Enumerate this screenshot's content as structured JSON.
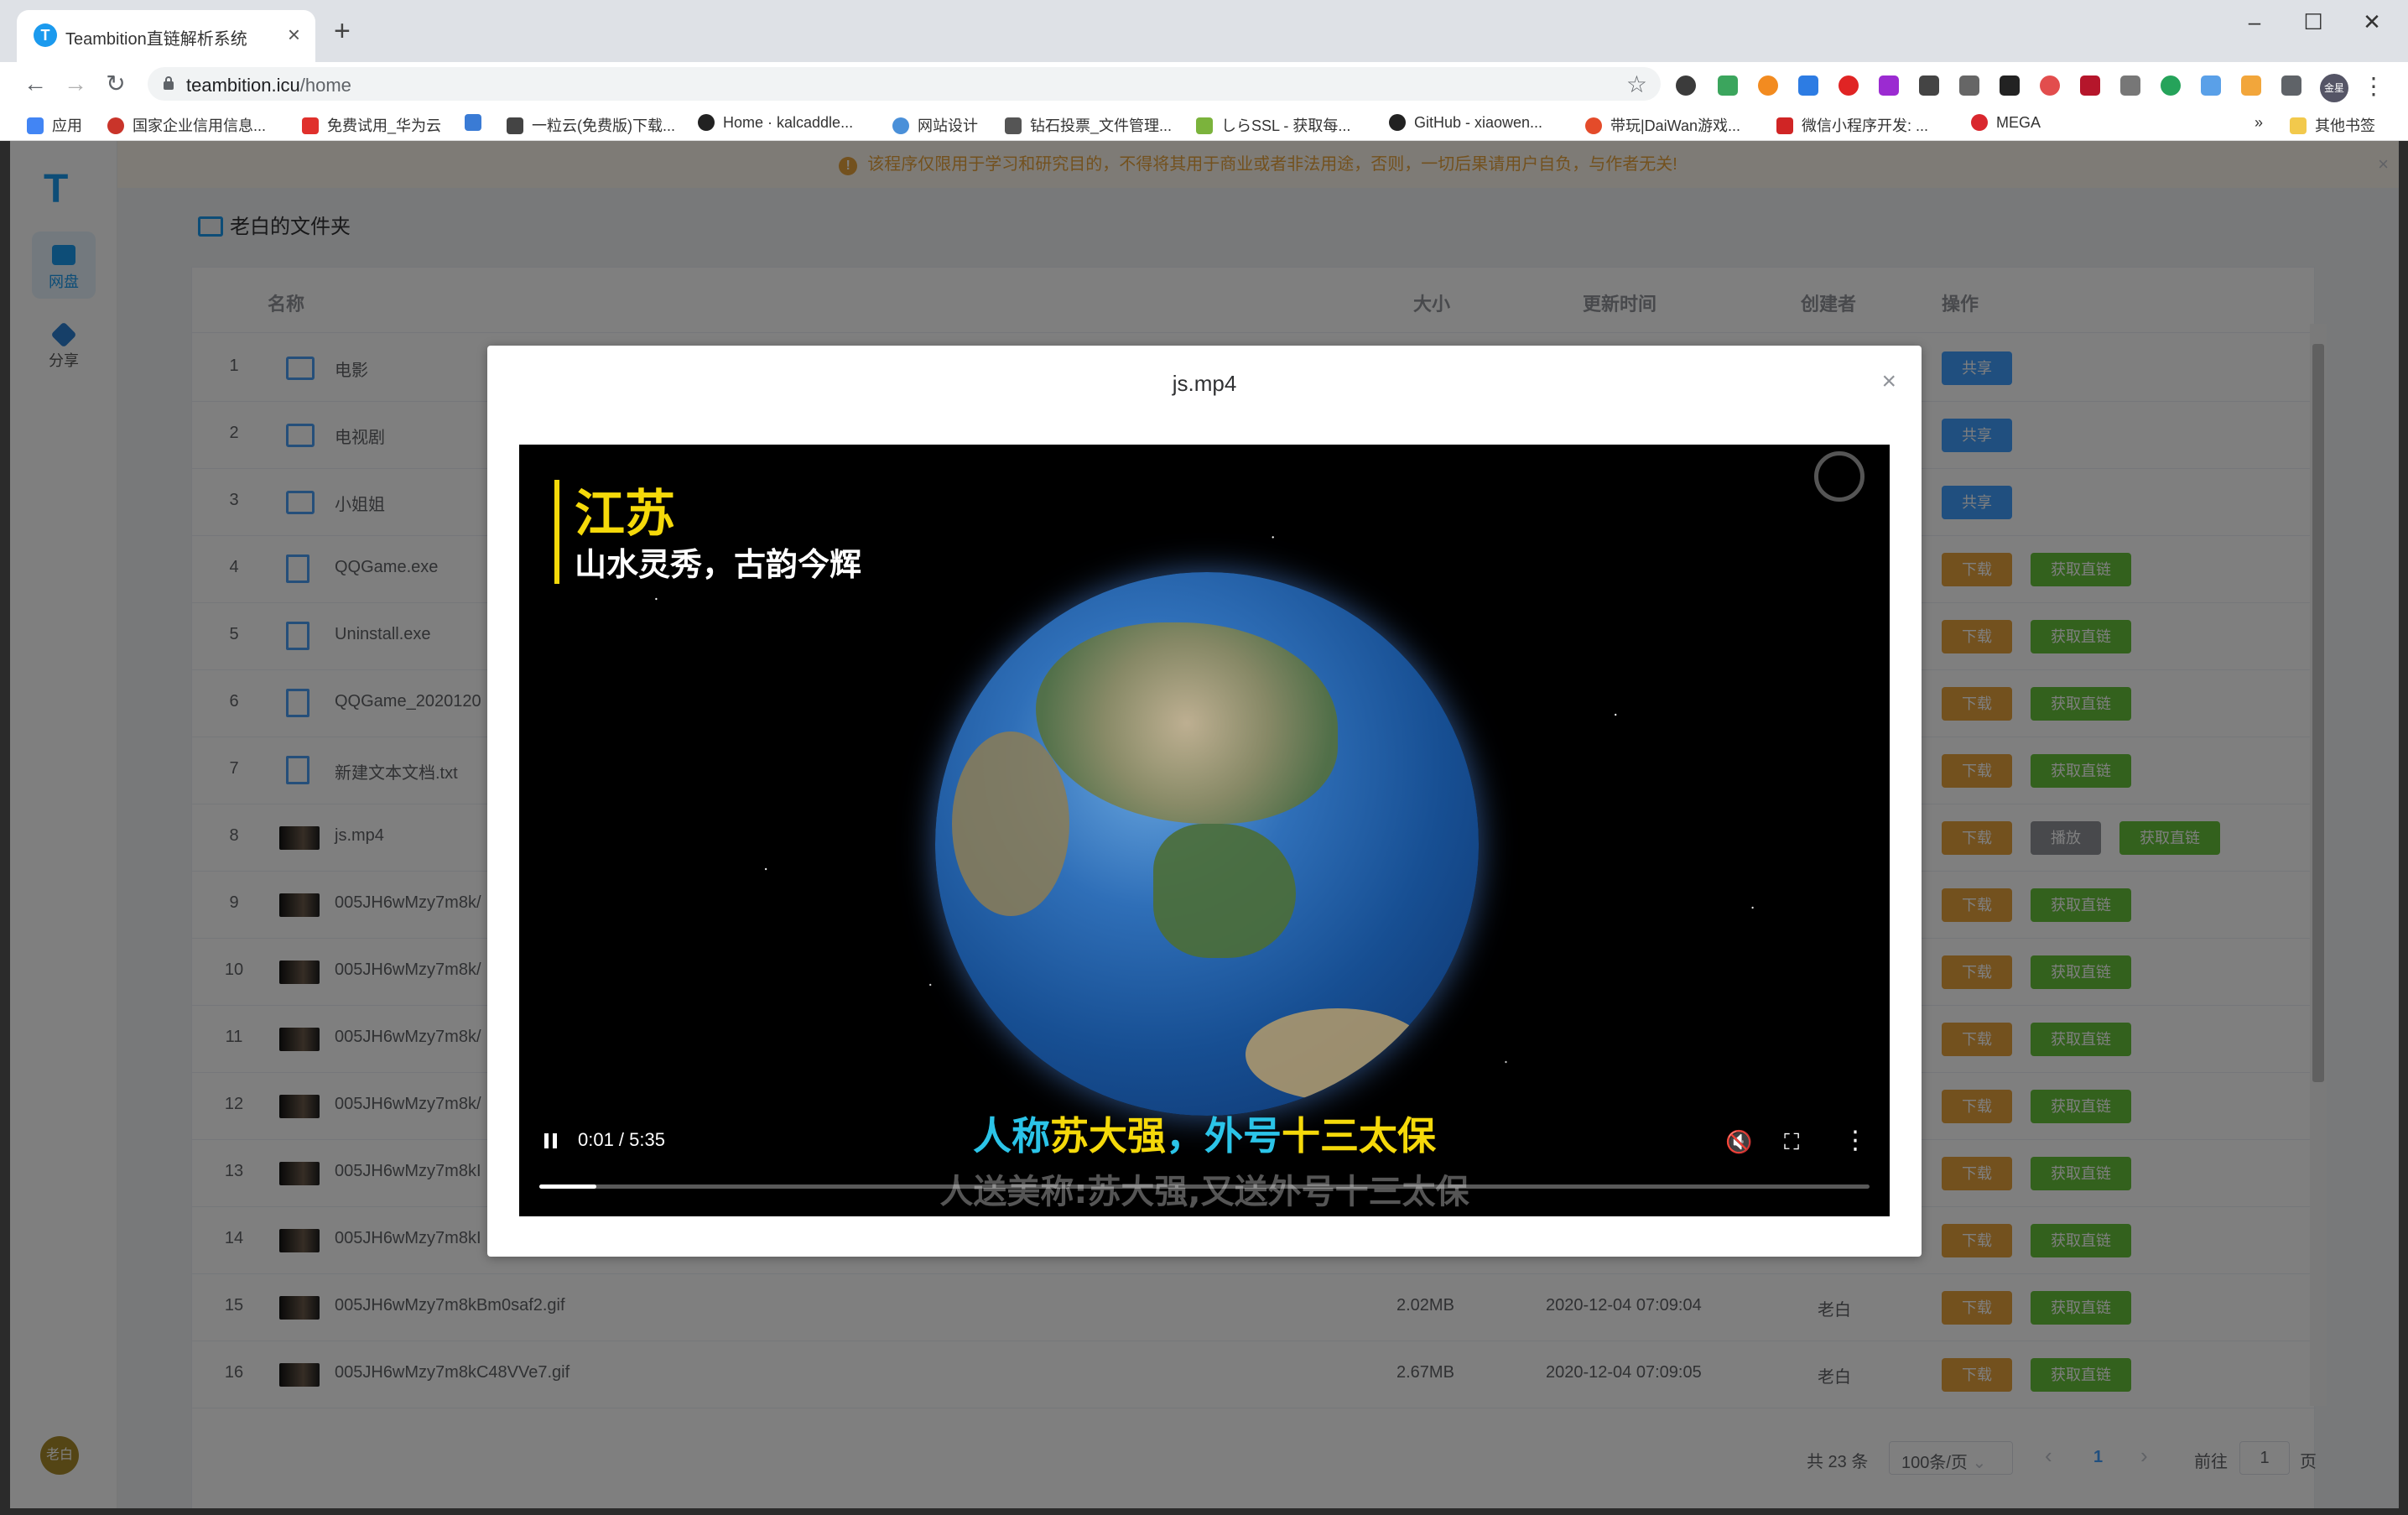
{
  "browser": {
    "tab_title": "Teambition直链解析系统",
    "tab_favicon": "T",
    "new_tab": "+",
    "url_host": "teambition.icu",
    "url_path": "/home",
    "window_controls": [
      "–",
      "☐",
      "✕"
    ]
  },
  "bookmarks": [
    {
      "label": "应用",
      "icon": "apps-grid-icon",
      "color": "#4285f4"
    },
    {
      "label": "国家企业信用信息...",
      "icon": "emblem-icon",
      "color": "#c9342a"
    },
    {
      "label": "免费试用_华为云",
      "icon": "huawei-icon",
      "color": "#e0302c"
    },
    {
      "label": "",
      "icon": "m-icon",
      "color": "#3a7bd5"
    },
    {
      "label": "一粒云(免费版)下载...",
      "icon": "doc-icon",
      "color": "#444"
    },
    {
      "label": "Home · kalcaddle...",
      "icon": "github-icon",
      "color": "#222"
    },
    {
      "label": "网站设计",
      "icon": "cloud-icon",
      "color": "#4a90d9"
    },
    {
      "label": "钻石投票_文件管理...",
      "icon": "vote-icon",
      "color": "#555"
    },
    {
      "label": "しらSSL - 获取每...",
      "icon": "ssl-icon",
      "color": "#7bb33c"
    },
    {
      "label": "GitHub - xiaowen...",
      "icon": "github-icon",
      "color": "#222"
    },
    {
      "label": "带玩|DaiWan游戏...",
      "icon": "daiwan-icon",
      "color": "#e44b2a"
    },
    {
      "label": "微信小程序开发: ...",
      "icon": "c-icon",
      "color": "#d02525"
    },
    {
      "label": "MEGA",
      "icon": "mega-icon",
      "color": "#d9272e"
    },
    {
      "label": "其他书签",
      "icon": "folder-icon",
      "color": "#f2c94c"
    }
  ],
  "bookmarks_more": "»",
  "profile_chip": "金星",
  "app": {
    "logo": "T",
    "nav": [
      {
        "label": "网盘",
        "active": true
      },
      {
        "label": "分享",
        "active": false
      }
    ],
    "user": "老白",
    "notice": "该程序仅限用于学习和研究目的，不得将其用于商业或者非法用途，否则，一切后果请用户自负，与作者无关!",
    "notice_icon": "!",
    "folder_title": "老白的文件夹",
    "columns": {
      "name": "名称",
      "size": "大小",
      "updated": "更新时间",
      "creator": "创建者",
      "action": "操作"
    },
    "buttons": {
      "share": "共享",
      "download": "下载",
      "play": "播放",
      "link": "获取直链"
    },
    "rows": [
      {
        "idx": "1",
        "name": "电影",
        "type": "folder",
        "size": "",
        "time": "",
        "creator": "",
        "actions": [
          "share"
        ]
      },
      {
        "idx": "2",
        "name": "电视剧",
        "type": "folder",
        "size": "",
        "time": "",
        "creator": "",
        "actions": [
          "share"
        ]
      },
      {
        "idx": "3",
        "name": "小姐姐",
        "type": "folder",
        "size": "",
        "time": "",
        "creator": "",
        "actions": [
          "share"
        ]
      },
      {
        "idx": "4",
        "name": "QQGame.exe",
        "type": "doc",
        "size": "",
        "time": "",
        "creator": "",
        "actions": [
          "download",
          "link"
        ]
      },
      {
        "idx": "5",
        "name": "Uninstall.exe",
        "type": "doc",
        "size": "",
        "time": "",
        "creator": "",
        "actions": [
          "download",
          "link"
        ]
      },
      {
        "idx": "6",
        "name": "QQGame_2020120",
        "type": "doc",
        "size": "",
        "time": "",
        "creator": "",
        "actions": [
          "download",
          "link"
        ]
      },
      {
        "idx": "7",
        "name": "新建文本文档.txt",
        "type": "doc",
        "size": "",
        "time": "",
        "creator": "",
        "actions": [
          "download",
          "link"
        ]
      },
      {
        "idx": "8",
        "name": "js.mp4",
        "type": "thumb",
        "size": "",
        "time": "",
        "creator": "",
        "actions": [
          "download",
          "play",
          "link"
        ]
      },
      {
        "idx": "9",
        "name": "005JH6wMzy7m8k/",
        "type": "thumb",
        "size": "",
        "time": "",
        "creator": "",
        "actions": [
          "download",
          "link"
        ]
      },
      {
        "idx": "10",
        "name": "005JH6wMzy7m8k/",
        "type": "thumb",
        "size": "",
        "time": "",
        "creator": "",
        "actions": [
          "download",
          "link"
        ]
      },
      {
        "idx": "11",
        "name": "005JH6wMzy7m8k/",
        "type": "thumb",
        "size": "",
        "time": "",
        "creator": "",
        "actions": [
          "download",
          "link"
        ]
      },
      {
        "idx": "12",
        "name": "005JH6wMzy7m8k/",
        "type": "thumb",
        "size": "",
        "time": "",
        "creator": "",
        "actions": [
          "download",
          "link"
        ]
      },
      {
        "idx": "13",
        "name": "005JH6wMzy7m8kI",
        "type": "thumb",
        "size": "",
        "time": "",
        "creator": "",
        "actions": [
          "download",
          "link"
        ]
      },
      {
        "idx": "14",
        "name": "005JH6wMzy7m8kI",
        "type": "thumb",
        "size": "",
        "time": "",
        "creator": "",
        "actions": [
          "download",
          "link"
        ]
      },
      {
        "idx": "15",
        "name": "005JH6wMzy7m8kBm0saf2.gif",
        "type": "thumb",
        "size": "2.02MB",
        "time": "2020-12-04 07:09:04",
        "creator": "老白",
        "actions": [
          "download",
          "link"
        ]
      },
      {
        "idx": "16",
        "name": "005JH6wMzy7m8kC48VVe7.gif",
        "type": "thumb",
        "size": "2.67MB",
        "time": "2020-12-04 07:09:05",
        "creator": "老白",
        "actions": [
          "download",
          "link"
        ]
      }
    ],
    "pagination": {
      "total": "共 23 条",
      "page_size": "100条/页",
      "prev": "‹",
      "current": "1",
      "next": "›",
      "goto_label": "前往",
      "goto_value": "1",
      "page_suffix": "页"
    }
  },
  "dialog": {
    "title": "js.mp4",
    "close": "×",
    "video": {
      "caption_title": "江苏",
      "caption_sub": "山水灵秀，古韵今辉",
      "subtitle_parts": [
        "人称",
        "苏大强",
        "，外号",
        "十三太保"
      ],
      "subtitle_secondary": "人送美称:苏大强,又送外号十三太保",
      "time": "0:01 / 5:35",
      "progress_fraction": 0.043,
      "muted": true,
      "colors": {
        "caption": "#f5d90a",
        "subtitle": "#2bc4e8"
      }
    }
  }
}
